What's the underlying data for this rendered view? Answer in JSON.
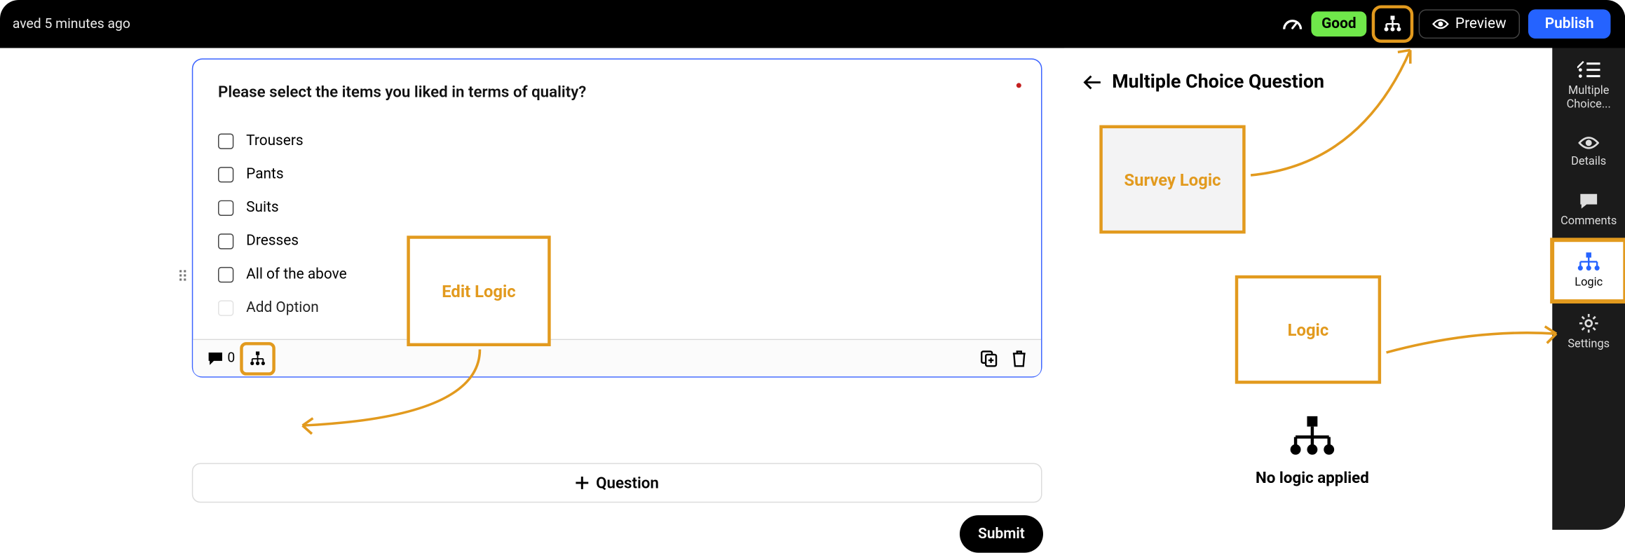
{
  "topbar": {
    "save_text": "aved 5 minutes ago",
    "good_label": "Good",
    "preview_label": "Preview",
    "publish_label": "Publish"
  },
  "question": {
    "text": "Please select the items you liked in terms of quality?",
    "options": [
      "Trousers",
      "Pants",
      "Suits",
      "Dresses",
      "All of the above"
    ],
    "add_option": "Add Option",
    "comment_count": "0"
  },
  "addq_label": "Question",
  "submit_label": "Submit",
  "panel": {
    "title": "Multiple Choice Question",
    "nologic": "No logic applied"
  },
  "sidebar": {
    "mc1": "Multiple",
    "mc2": "Choice...",
    "details": "Details",
    "comments": "Comments",
    "logic": "Logic",
    "settings": "Settings"
  },
  "callouts": {
    "edit": "Edit Logic",
    "survey": "Survey Logic",
    "logic": "Logic"
  }
}
